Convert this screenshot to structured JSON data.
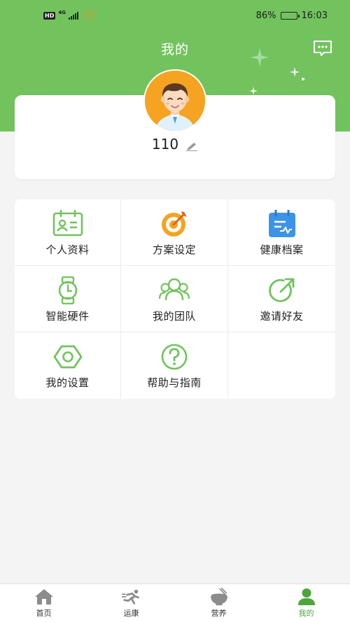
{
  "status_bar": {
    "hd": "HD",
    "network": "4G",
    "battery_percent": "86%",
    "battery_level": 0.86,
    "time": "16:03"
  },
  "header": {
    "title": "我的",
    "message_icon": "message-icon",
    "background_color": "#72c35e"
  },
  "profile": {
    "avatar": "avatar-cartoon-man",
    "username": "110",
    "edit_icon": "pencil-icon"
  },
  "menu": {
    "items": [
      {
        "label": "个人资料",
        "icon": "id-card-icon"
      },
      {
        "label": "方案设定",
        "icon": "target-icon"
      },
      {
        "label": "健康档案",
        "icon": "health-record-icon"
      },
      {
        "label": "智能硬件",
        "icon": "smartwatch-icon"
      },
      {
        "label": "我的团队",
        "icon": "team-icon"
      },
      {
        "label": "邀请好友",
        "icon": "share-arrow-icon"
      },
      {
        "label": "我的设置",
        "icon": "settings-hexagon-icon"
      },
      {
        "label": "帮助与指南",
        "icon": "help-icon"
      }
    ]
  },
  "tab_bar": {
    "tabs": [
      {
        "label": "首页",
        "icon": "home-icon",
        "active": false
      },
      {
        "label": "运康",
        "icon": "running-icon",
        "active": false
      },
      {
        "label": "营养",
        "icon": "nutrition-bowl-icon",
        "active": false
      },
      {
        "label": "我的",
        "icon": "person-icon",
        "active": true
      }
    ],
    "active_color": "#4ca63b"
  }
}
